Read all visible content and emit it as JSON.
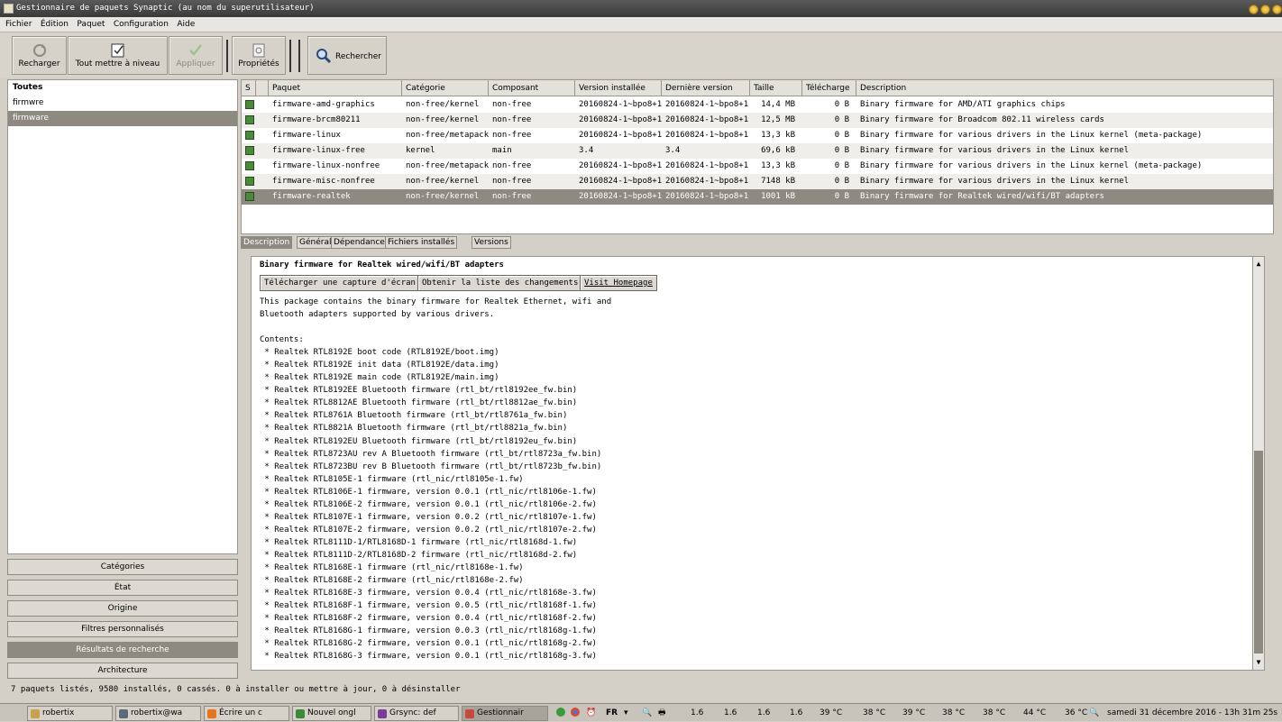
{
  "window": {
    "title": "Gestionnaire de paquets Synaptic  (au nom du superutilisateur)"
  },
  "menu": [
    "Fichier",
    "Édition",
    "Paquet",
    "Configuration",
    "Aide"
  ],
  "toolbar": {
    "reload": "Recharger",
    "upgrade_all": "Tout mettre à niveau",
    "apply": "Appliquer",
    "properties": "Propriétés",
    "search": "Rechercher"
  },
  "sidebar": {
    "items": [
      {
        "label": "Toutes"
      },
      {
        "label": "firmwre"
      },
      {
        "label": "firmware"
      }
    ],
    "filters": [
      "Catégories",
      "État",
      "Origine",
      "Filtres personnalisés",
      "Résultats de recherche",
      "Architecture"
    ]
  },
  "table": {
    "headers": [
      "S",
      "",
      "Paquet",
      "Catégorie",
      "Composant",
      "Version installée",
      "Dernière version",
      "Taille",
      "Télécharge",
      "Description"
    ],
    "rows": [
      {
        "name": "firmware-amd-graphics",
        "category": "non-free/kernel",
        "component": "non-free",
        "installed": "20160824-1~bpo8+1",
        "latest": "20160824-1~bpo8+1",
        "size": "14,4 MB",
        "download": "0  B",
        "description": "Binary firmware for AMD/ATI graphics chips"
      },
      {
        "name": "firmware-brcm80211",
        "category": "non-free/kernel",
        "component": "non-free",
        "installed": "20160824-1~bpo8+1",
        "latest": "20160824-1~bpo8+1",
        "size": "12,5 MB",
        "download": "0  B",
        "description": "Binary firmware for Broadcom 802.11 wireless cards"
      },
      {
        "name": "firmware-linux",
        "category": "non-free/metapacka",
        "component": "non-free",
        "installed": "20160824-1~bpo8+1",
        "latest": "20160824-1~bpo8+1",
        "size": "13,3 kB",
        "download": "0  B",
        "description": "Binary firmware for various drivers in the Linux kernel (meta-package)"
      },
      {
        "name": "firmware-linux-free",
        "category": "kernel",
        "component": "main",
        "installed": "3.4",
        "latest": "3.4",
        "size": "69,6 kB",
        "download": "0  B",
        "description": "Binary firmware for various drivers in the Linux kernel"
      },
      {
        "name": "firmware-linux-nonfree",
        "category": "non-free/metapacka",
        "component": "non-free",
        "installed": "20160824-1~bpo8+1",
        "latest": "20160824-1~bpo8+1",
        "size": "13,3 kB",
        "download": "0  B",
        "description": "Binary firmware for various drivers in the Linux kernel (meta-package)"
      },
      {
        "name": "firmware-misc-nonfree",
        "category": "non-free/kernel",
        "component": "non-free",
        "installed": "20160824-1~bpo8+1",
        "latest": "20160824-1~bpo8+1",
        "size": "7148 kB",
        "download": "0  B",
        "description": "Binary firmware for various drivers in the Linux kernel"
      },
      {
        "name": "firmware-realtek",
        "category": "non-free/kernel",
        "component": "non-free",
        "installed": "20160824-1~bpo8+1",
        "latest": "20160824-1~bpo8+1",
        "size": "1001 kB",
        "download": "0  B",
        "description": "Binary firmware for Realtek wired/wifi/BT adapters"
      }
    ]
  },
  "tabs": [
    "Description",
    "Général",
    "Dépendances",
    "Fichiers installés",
    "Versions"
  ],
  "detail": {
    "title": "Binary firmware for Realtek wired/wifi/BT adapters",
    "buttons": [
      "Télécharger une capture d'écran",
      "Obtenir la liste des changements",
      "Visit Homepage"
    ],
    "lines": [
      "This package contains the binary firmware for Realtek Ethernet, wifi and",
      "Bluetooth adapters supported by various drivers.",
      "",
      "Contents:",
      " * Realtek RTL8192E boot code (RTL8192E/boot.img)",
      " * Realtek RTL8192E init data (RTL8192E/data.img)",
      " * Realtek RTL8192E main code (RTL8192E/main.img)",
      " * Realtek RTL8192EE Bluetooth firmware (rtl_bt/rtl8192ee_fw.bin)",
      " * Realtek RTL8812AE Bluetooth firmware (rtl_bt/rtl8812ae_fw.bin)",
      " * Realtek RTL8761A Bluetooth firmware (rtl_bt/rtl8761a_fw.bin)",
      " * Realtek RTL8821A Bluetooth firmware (rtl_bt/rtl8821a_fw.bin)",
      " * Realtek RTL8192EU Bluetooth firmware (rtl_bt/rtl8192eu_fw.bin)",
      " * Realtek RTL8723AU rev A Bluetooth firmware (rtl_bt/rtl8723a_fw.bin)",
      " * Realtek RTL8723BU rev B Bluetooth firmware (rtl_bt/rtl8723b_fw.bin)",
      " * Realtek RTL8105E-1 firmware (rtl_nic/rtl8105e-1.fw)",
      " * Realtek RTL8106E-1 firmware, version 0.0.1 (rtl_nic/rtl8106e-1.fw)",
      " * Realtek RTL8106E-2 firmware, version 0.0.1 (rtl_nic/rtl8106e-2.fw)",
      " * Realtek RTL8107E-1 firmware, version 0.0.2 (rtl_nic/rtl8107e-1.fw)",
      " * Realtek RTL8107E-2 firmware, version 0.0.2 (rtl_nic/rtl8107e-2.fw)",
      " * Realtek RTL8111D-1/RTL8168D-1 firmware (rtl_nic/rtl8168d-1.fw)",
      " * Realtek RTL8111D-2/RTL8168D-2 firmware (rtl_nic/rtl8168d-2.fw)",
      " * Realtek RTL8168E-1 firmware (rtl_nic/rtl8168e-1.fw)",
      " * Realtek RTL8168E-2 firmware (rtl_nic/rtl8168e-2.fw)",
      " * Realtek RTL8168E-3 firmware, version 0.0.4 (rtl_nic/rtl8168e-3.fw)",
      " * Realtek RTL8168F-1 firmware, version 0.0.5 (rtl_nic/rtl8168f-1.fw)",
      " * Realtek RTL8168F-2 firmware, version 0.0.4 (rtl_nic/rtl8168f-2.fw)",
      " * Realtek RTL8168G-1 firmware, version 0.0.3 (rtl_nic/rtl8168g-1.fw)",
      " * Realtek RTL8168G-2 firmware, version 0.0.1 (rtl_nic/rtl8168g-2.fw)",
      " * Realtek RTL8168G-3 firmware, version 0.0.1 (rtl_nic/rtl8168g-3.fw)"
    ]
  },
  "status": "7 paquets listés, 9580 installés, 0 cassés. 0 à installer ou mettre à jour, 0 à désinstaller",
  "taskbar": {
    "tasks": [
      {
        "label": "robertix",
        "icon": "folder-icon",
        "color": "#c8a24a"
      },
      {
        "label": "robertix@wa",
        "icon": "terminal-icon",
        "color": "#5a6a7a"
      },
      {
        "label": "Écrire un c",
        "icon": "firefox-icon",
        "color": "#e8741c"
      },
      {
        "label": "Nouvel ongl",
        "icon": "chrome-icon",
        "color": "#3a8a3a"
      },
      {
        "label": "Grsync: def",
        "icon": "grsync-icon",
        "color": "#7a3a9a"
      },
      {
        "label": "Gestionnair",
        "icon": "synaptic-icon",
        "color": "#c84a3a"
      }
    ],
    "tray": {
      "lang": "FR",
      "loads": [
        "1.6",
        "1.6",
        "1.6",
        "1.6"
      ],
      "temps": [
        "39 °C",
        "38 °C",
        "39 °C",
        "38 °C",
        "38 °C",
        "44 °C",
        "36 °C"
      ],
      "clock": "samedi 31 décembre 2016 - 13h 31m 25s"
    }
  }
}
